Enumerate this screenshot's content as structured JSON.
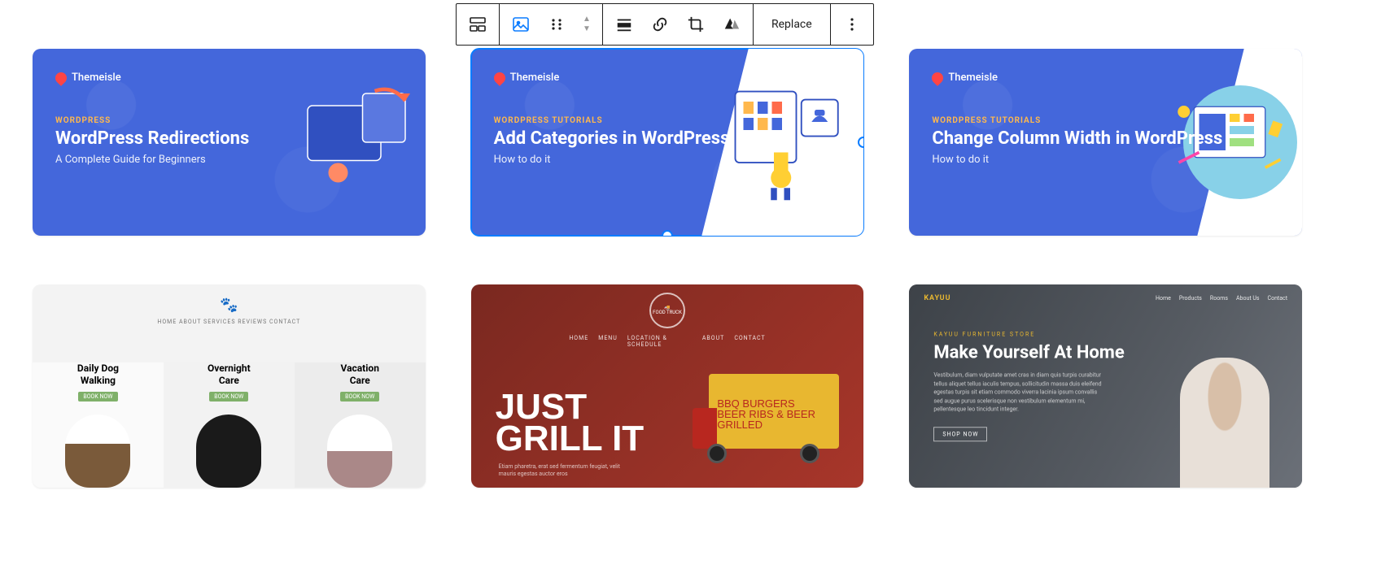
{
  "toolbar": {
    "replace_label": "Replace"
  },
  "cards": {
    "redirections": {
      "brand": "Themeisle",
      "eyebrow": "WORDPRESS",
      "title": "WordPress Redirections",
      "subtitle": "A Complete Guide for Beginners"
    },
    "categories": {
      "brand": "Themeisle",
      "eyebrow": "WORDPRESS TUTORIALS",
      "title": "Add Categories in WordPress",
      "subtitle": "How to do it"
    },
    "column_width": {
      "brand": "Themeisle",
      "eyebrow": "WORDPRESS TUTORIALS",
      "title": "Change Column Width in WordPress",
      "subtitle": "How to do it"
    },
    "dog": {
      "nav": "HOME   ABOUT   SERVICES   REVIEWS   CONTACT",
      "cols": [
        {
          "line1": "Daily Dog",
          "line2": "Walking",
          "btn": "BOOK NOW"
        },
        {
          "line1": "Overnight",
          "line2": "Care",
          "btn": "BOOK NOW"
        },
        {
          "line1": "Vacation",
          "line2": "Care",
          "btn": "BOOK NOW"
        }
      ]
    },
    "food": {
      "logo_top": "FOOD TRUCK",
      "nav": [
        "HOME",
        "MENU",
        "LOCATION & SCHEDULE",
        "ABOUT",
        "CONTACT"
      ],
      "hero_l1": "JUST",
      "hero_l2": "GRILL IT",
      "sub": "Etiam pharetra, erat sed fermentum feugiat, velit mauris egestas auctor eros",
      "truck_l1": "BBQ BURGERS",
      "truck_l2": "BEER RIBS & BEER",
      "truck_l3": "GRILLED"
    },
    "kayuu": {
      "logo": "KAYUU",
      "links": [
        "Home",
        "Products",
        "Rooms",
        "About Us",
        "Contact"
      ],
      "eyebrow": "KAYUU FURNITURE STORE",
      "title": "Make Yourself At Home",
      "body": "Vestibulum, diam vulputate amet cras in diam quis turpis curabitur tellus aliquet tellus iaculis tempus, sollicitudin massa duis eleifend egestas turpis sit etiam commodo viverra lacinia ipsum convallis sed augue purus scelerisque non vestibulum elementum mi, pellentesque leo tincidunt integer.",
      "btn": "SHOP NOW"
    }
  }
}
